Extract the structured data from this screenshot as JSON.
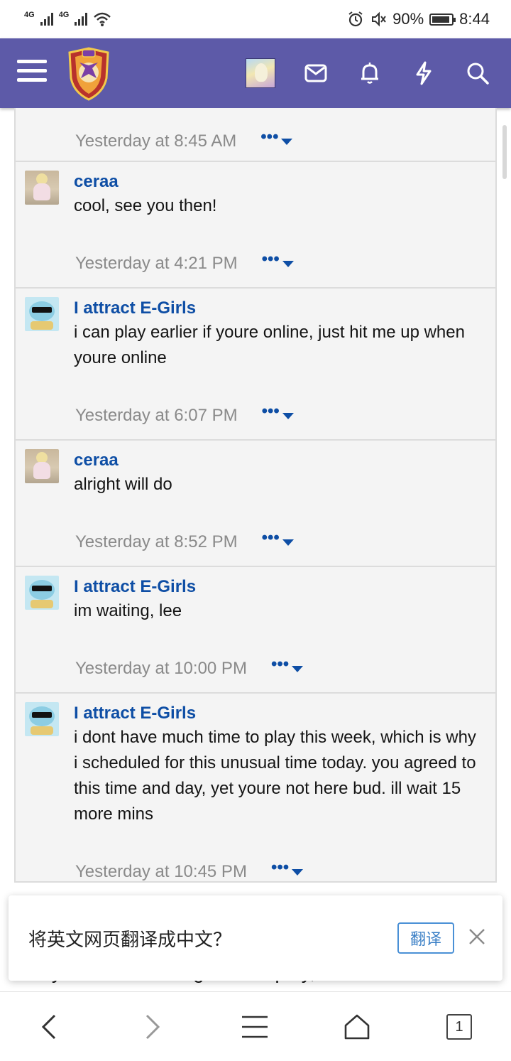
{
  "status_bar": {
    "signal1": "4G",
    "signal2": "4G",
    "battery": "90%",
    "time": "8:44"
  },
  "header": {
    "icons": [
      "menu-icon",
      "site-logo",
      "user-avatar",
      "mail-icon",
      "bell-icon",
      "bolt-icon",
      "search-icon"
    ]
  },
  "thread": {
    "messages": [
      {
        "user": "",
        "text": "",
        "time": "Yesterday at 8:45 AM",
        "avatar": "none"
      },
      {
        "user": "ceraa",
        "text": "cool, see you then!",
        "time": "Yesterday at 4:21 PM",
        "avatar": "ceraa"
      },
      {
        "user": "I attract E-Girls",
        "text": "i can play earlier if youre online, just hit me up when youre online",
        "time": "Yesterday at 6:07 PM",
        "avatar": "squirtle"
      },
      {
        "user": "ceraa",
        "text": "alright will do",
        "time": "Yesterday at 8:52 PM",
        "avatar": "ceraa"
      },
      {
        "user": "I attract E-Girls",
        "text": "im waiting, lee",
        "time": "Yesterday at 10:00 PM",
        "avatar": "squirtle"
      },
      {
        "user": "I attract E-Girls",
        "text": "i dont have much time to play this week, which is why i scheduled for this unusual time today. you agreed to this time and day, yet youre not here bud. ill wait 15 more mins",
        "time": "Yesterday at 10:45 PM",
        "avatar": "squirtle"
      }
    ],
    "more_label": "•••"
  },
  "partial_text": "Sorry about not being able to play, I can't connect",
  "translate_bar": {
    "prompt": "将英文网页翻译成中文？",
    "button": "翻译"
  },
  "bottom_nav": {
    "tabs_count": "1"
  },
  "colors": {
    "header": "#5d5aa8",
    "link": "#0e4ea5",
    "timestamp": "#8a8a8a"
  }
}
